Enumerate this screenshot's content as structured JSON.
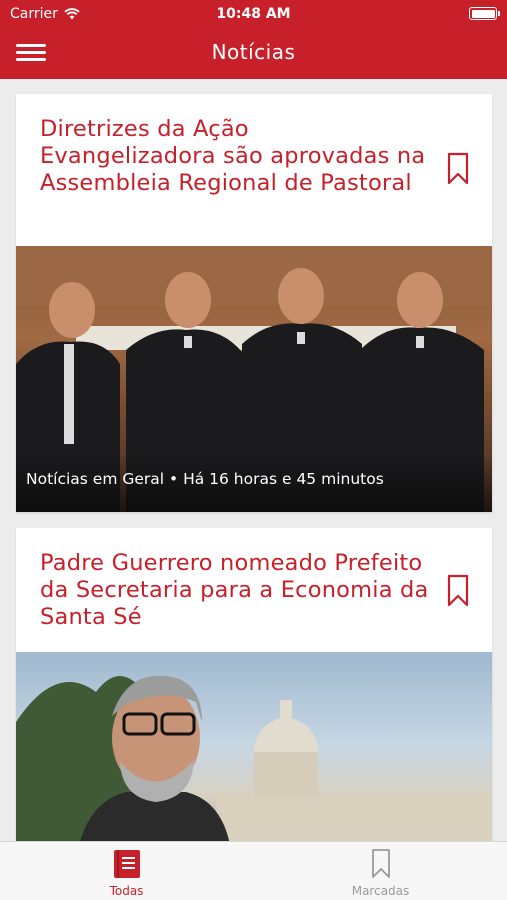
{
  "status_bar": {
    "carrier": "Carrier",
    "time": "10:48 AM"
  },
  "nav": {
    "title": "Notícias",
    "menu_icon": "hamburger-menu-icon"
  },
  "articles": [
    {
      "title": "Diretrizes da Ação Evangelizadora são aprovadas na Assembleia Regional de Pastoral",
      "caption": "Notícias em Geral • Há 16 horas e 45 minutos",
      "bookmark_icon": "bookmark-icon"
    },
    {
      "title": "Padre Guerrero nomeado Prefeito da Secretaria para a Economia da Santa Sé",
      "bookmark_icon": "bookmark-icon"
    }
  ],
  "tabbar": {
    "tabs": [
      {
        "label": "Todas",
        "icon": "book-icon",
        "active": true
      },
      {
        "label": "Marcadas",
        "icon": "bookmark-icon",
        "active": false
      }
    ]
  },
  "colors": {
    "brand": "#c7202a",
    "inactive": "#9a9a9a",
    "background": "#ececec"
  }
}
